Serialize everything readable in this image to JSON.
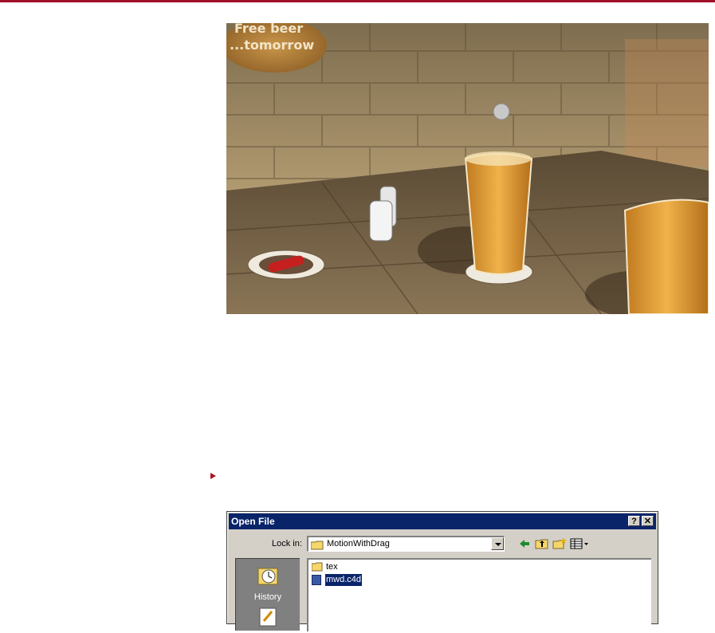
{
  "render": {
    "sign_text_line1": "Free beer",
    "sign_text_line2": "...tomorrow"
  },
  "dialog": {
    "title": "Open File",
    "help_button": "?",
    "close_button": "✕",
    "lookin_label": "Lock in:",
    "lookin_value": "MotionWithDrag",
    "places": [
      {
        "label": "History",
        "icon": "history-icon"
      },
      {
        "label": "",
        "icon": "desktop-icon"
      }
    ],
    "files": [
      {
        "name": "tex",
        "icon": "folder-icon",
        "selected": false
      },
      {
        "name": "mwd.c4d",
        "icon": "c4d-file-icon",
        "selected": true
      }
    ]
  },
  "colors": {
    "accent_rule": "#a0102a",
    "titlebar": "#0a246a",
    "dialog_bg": "#d4d0c8"
  }
}
